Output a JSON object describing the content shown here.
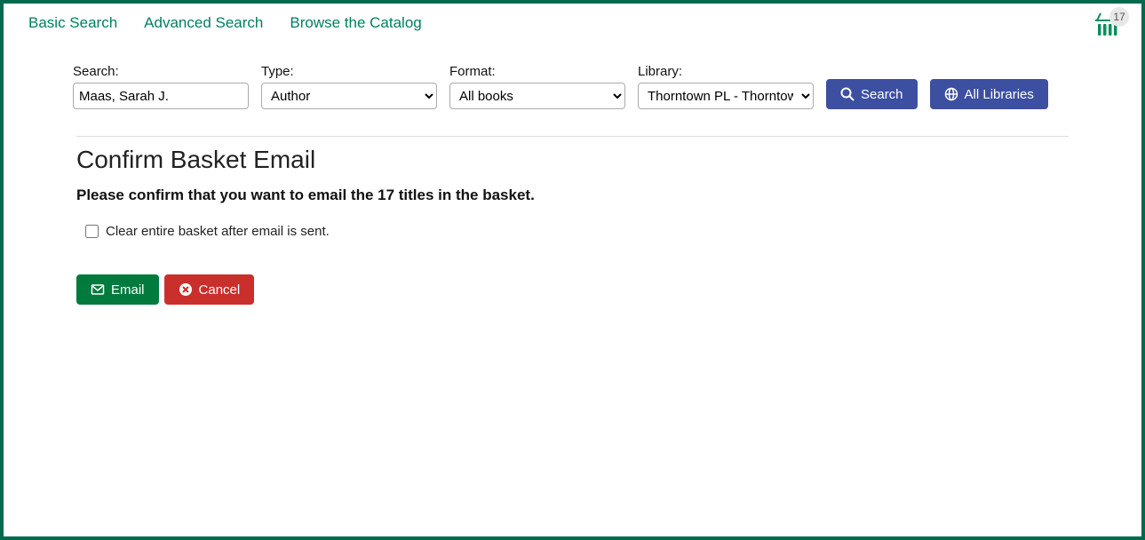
{
  "nav": {
    "basic": "Basic Search",
    "advanced": "Advanced Search",
    "browse": "Browse the Catalog"
  },
  "basket": {
    "count": "17"
  },
  "search": {
    "label": "Search:",
    "value": "Maas, Sarah J.",
    "type_label": "Type:",
    "type_value": "Author",
    "format_label": "Format:",
    "format_value": "All books",
    "library_label": "Library:",
    "library_value": "Thorntown PL - Thorntown",
    "search_btn": "Search",
    "all_libraries_btn": "All Libraries"
  },
  "page": {
    "heading": "Confirm Basket Email",
    "confirm_text": "Please confirm that you want to email the 17 titles in the basket.",
    "checkbox_label": "Clear entire basket after email is sent.",
    "email_btn": "Email",
    "cancel_btn": "Cancel"
  }
}
